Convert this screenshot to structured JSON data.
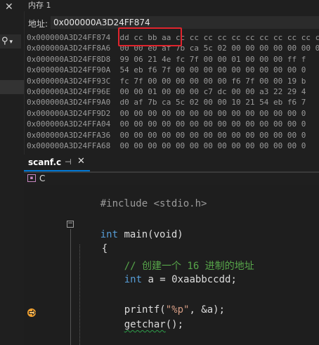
{
  "left_panel": {
    "close": "✕",
    "search_icon": "⚲",
    "search_dropdown": "▾"
  },
  "memory": {
    "title": "内存 1",
    "address_label": "地址:",
    "address_value": "0x000000A3D24FF874",
    "rows": [
      {
        "addr": "0x000000A3D24FF874",
        "bytes": "dd cc bb aa cc cc cc cc cc cc cc cc cc cc c"
      },
      {
        "addr": "0x000000A3D24FF8A6",
        "bytes": "00 00 e0 af 7b ca 5c 02 00 00 00 00 00 00 0"
      },
      {
        "addr": "0x000000A3D24FF8D8",
        "bytes": "99 06 21 4e fc 7f 00 00 01 00 00 00 ff f"
      },
      {
        "addr": "0x000000A3D24FF90A",
        "bytes": "54 eb f6 7f 00 00 00 00 00 00 00 00 00 0"
      },
      {
        "addr": "0x000000A3D24FF93C",
        "bytes": "fc 7f 00 00 00 00 00 00 f6 7f 00 00 19 b"
      },
      {
        "addr": "0x000000A3D24FF96E",
        "bytes": "00 00 01 00 00 00 c7 dc 00 00 a3 22 29 4"
      },
      {
        "addr": "0x000000A3D24FF9A0",
        "bytes": "d0 af 7b ca 5c 02 00 00 10 21 54 eb f6 7"
      },
      {
        "addr": "0x000000A3D24FF9D2",
        "bytes": "00 00 00 00 00 00 00 00 00 00 00 00 00 0"
      },
      {
        "addr": "0x000000A3D24FFA04",
        "bytes": "00 00 00 00 00 00 00 00 00 00 00 00 00 0"
      },
      {
        "addr": "0x000000A3D24FFA36",
        "bytes": "00 00 00 00 00 00 00 00 00 00 00 00 00 0"
      },
      {
        "addr": "0x000000A3D24FFA68",
        "bytes": "00 00 00 00 00 00 00 00 00 00 00 00 00 0"
      }
    ]
  },
  "editor": {
    "tab_label": "scanf.c",
    "tab_pin": "⊣",
    "tab_close": "✕",
    "scope_label": "C",
    "code": {
      "include": "#include <stdio.h>",
      "int_kw": "int",
      "main_rest": " main(void)",
      "open_brace": "{",
      "comment": "// 创建一个 16 进制的地址",
      "decl_kw": "int",
      "decl_rest": " a = ",
      "decl_num": "0xaabbccdd",
      "decl_end": ";",
      "printf_name": "printf(",
      "printf_str": "\"%p\"",
      "printf_rest": ", &a);",
      "getchar_name": "getchar",
      "getchar_rest": "();"
    }
  },
  "colors": {
    "background": "#1f1f1f",
    "highlight_box": "#e0242d",
    "keyword": "#569cd6",
    "comment": "#57a64a",
    "active_tab_accent": "#0078d4",
    "breakpoint_arrow": "#f0a030"
  }
}
